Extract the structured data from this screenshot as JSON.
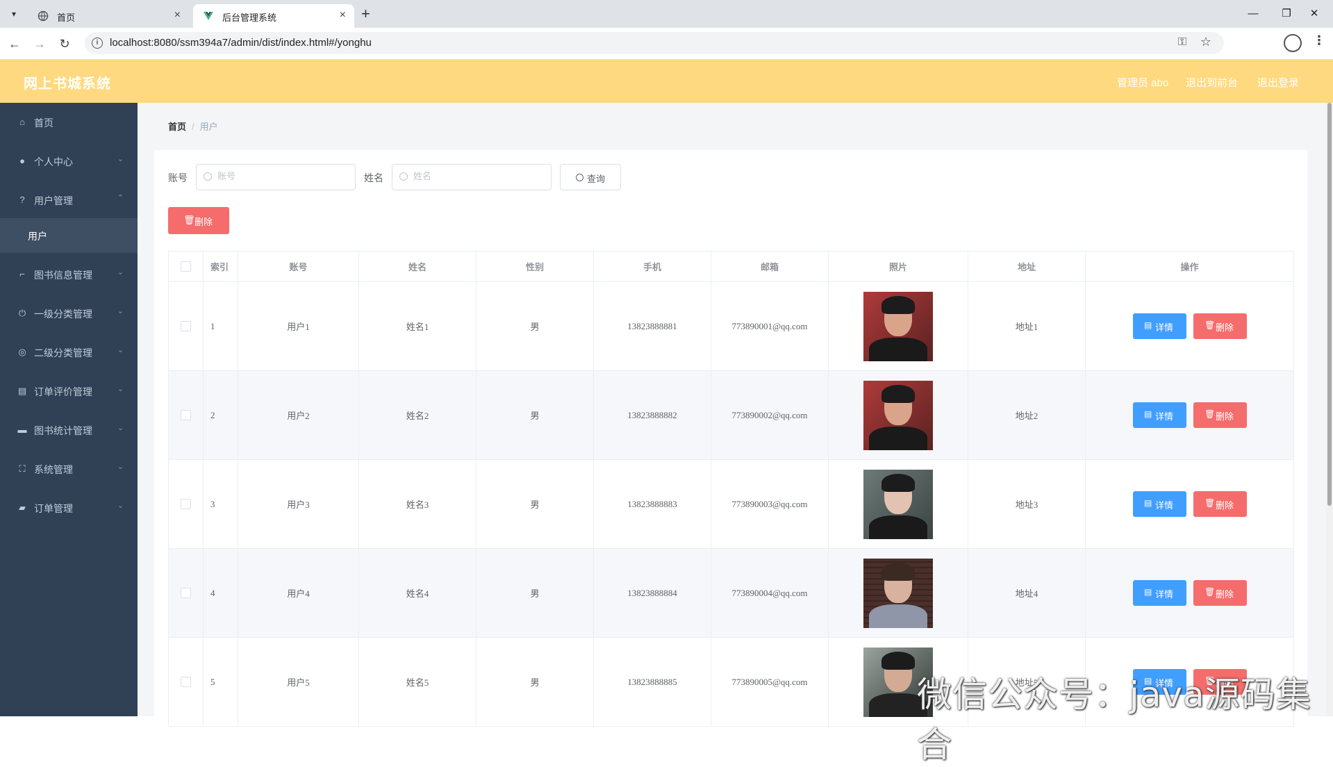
{
  "browser": {
    "tabs": [
      {
        "title": "首页",
        "active": false
      },
      {
        "title": "后台管理系统",
        "active": true
      }
    ],
    "url": "localhost:8080/ssm394a7/admin/dist/index.html#/yonghu"
  },
  "header": {
    "title": "网上书城系统",
    "user_label": "管理员 abo",
    "front_link": "退出到前台",
    "logout_link": "退出登录",
    "bg_color": "#ffd97f"
  },
  "sidebar": {
    "items": [
      {
        "label": "首页",
        "icon": "home-icon",
        "arrow": false
      },
      {
        "label": "个人中心",
        "icon": "user-icon",
        "arrow": true
      },
      {
        "label": "用户管理",
        "icon": "help-circle-icon",
        "arrow": true,
        "expanded": true
      },
      {
        "label": "图书信息管理",
        "icon": "crop-icon",
        "arrow": true
      },
      {
        "label": "一级分类管理",
        "icon": "power-icon",
        "arrow": true
      },
      {
        "label": "二级分类管理",
        "icon": "compass-icon",
        "arrow": true
      },
      {
        "label": "订单评价管理",
        "icon": "document-icon",
        "arrow": true
      },
      {
        "label": "图书统计管理",
        "icon": "message-icon",
        "arrow": true
      },
      {
        "label": "系统管理",
        "icon": "fullscreen-icon",
        "arrow": true
      },
      {
        "label": "订单管理",
        "icon": "goods-icon",
        "arrow": true
      }
    ],
    "sub_item": "用户"
  },
  "breadcrumb": {
    "home": "首页",
    "current": "用户"
  },
  "search": {
    "account_label": "账号",
    "account_placeholder": "账号",
    "name_label": "姓名",
    "name_placeholder": "姓名",
    "query_button": "查询"
  },
  "toolbar": {
    "delete_button": "删除"
  },
  "table": {
    "headers": [
      "索引",
      "账号",
      "姓名",
      "性别",
      "手机",
      "邮箱",
      "照片",
      "地址",
      "操作"
    ],
    "rows": [
      {
        "index": "1",
        "account": "用户1",
        "name": "姓名1",
        "sex": "男",
        "phone": "13823888881",
        "email": "773890001@qq.com",
        "address": "地址1"
      },
      {
        "index": "2",
        "account": "用户2",
        "name": "姓名2",
        "sex": "男",
        "phone": "13823888882",
        "email": "773890002@qq.com",
        "address": "地址2"
      },
      {
        "index": "3",
        "account": "用户3",
        "name": "姓名3",
        "sex": "男",
        "phone": "13823888883",
        "email": "773890003@qq.com",
        "address": "地址3"
      },
      {
        "index": "4",
        "account": "用户4",
        "name": "姓名4",
        "sex": "男",
        "phone": "13823888884",
        "email": "773890004@qq.com",
        "address": "地址4"
      },
      {
        "index": "5",
        "account": "用户5",
        "name": "姓名5",
        "sex": "男",
        "phone": "13823888885",
        "email": "773890005@qq.com",
        "address": "地址5"
      }
    ],
    "detail_button": "详情",
    "delete_button": "删除"
  },
  "watermark": "微信公众号：java源码集合",
  "colors": {
    "primary": "#409eff",
    "danger": "#f56c6c",
    "sidebar": "#304156"
  }
}
